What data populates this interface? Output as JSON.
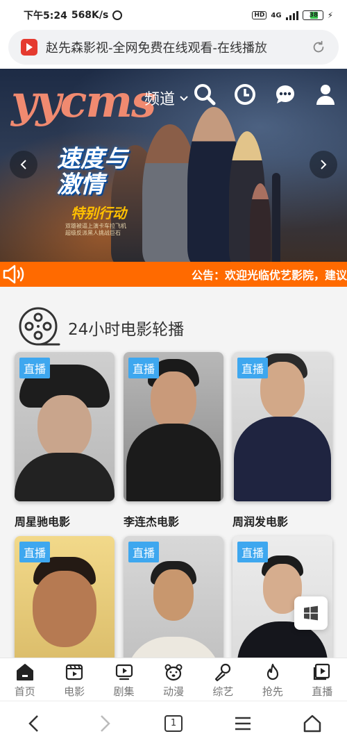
{
  "status_bar": {
    "time": "下午5:24",
    "net_speed": "568K/s",
    "hd_label": "HD",
    "network": "4G",
    "battery": "38"
  },
  "browser": {
    "page_title": "赵先森影视-全网免费在线观看-在线播放",
    "tab_count": "1"
  },
  "header": {
    "logo": "yycms",
    "channel_label": "频道",
    "icons": [
      "search-icon",
      "history-icon",
      "message-icon",
      "user-icon"
    ]
  },
  "banner": {
    "title_line1": "速度与",
    "title_line2": "激情",
    "subtitle": "特别行动",
    "small_text": "双雄被逼上演卡车拉飞机 超级反派黑人挑战巨石"
  },
  "notice": {
    "text": "公告：欢迎光临优艺影院，建议"
  },
  "section": {
    "title": "24小时电影轮播",
    "items": [
      {
        "badge": "直播",
        "name": "周星驰电影"
      },
      {
        "badge": "直播",
        "name": "李连杰电影"
      },
      {
        "badge": "直播",
        "name": "周润发电影"
      },
      {
        "badge": "直播",
        "name": ""
      },
      {
        "badge": "直播",
        "name": ""
      },
      {
        "badge": "直播",
        "name": ""
      }
    ]
  },
  "tabbar": {
    "items": [
      {
        "label": "首页",
        "icon": "home-icon",
        "active": true
      },
      {
        "label": "电影",
        "icon": "film-icon"
      },
      {
        "label": "剧集",
        "icon": "tv-icon"
      },
      {
        "label": "动漫",
        "icon": "bear-icon"
      },
      {
        "label": "综艺",
        "icon": "microphone-icon"
      },
      {
        "label": "抢先",
        "icon": "fire-icon"
      },
      {
        "label": "直播",
        "icon": "live-icon"
      }
    ]
  },
  "colors": {
    "accent": "#ff6a00",
    "badge": "#3ea7ef",
    "logo": "#f08a70"
  }
}
